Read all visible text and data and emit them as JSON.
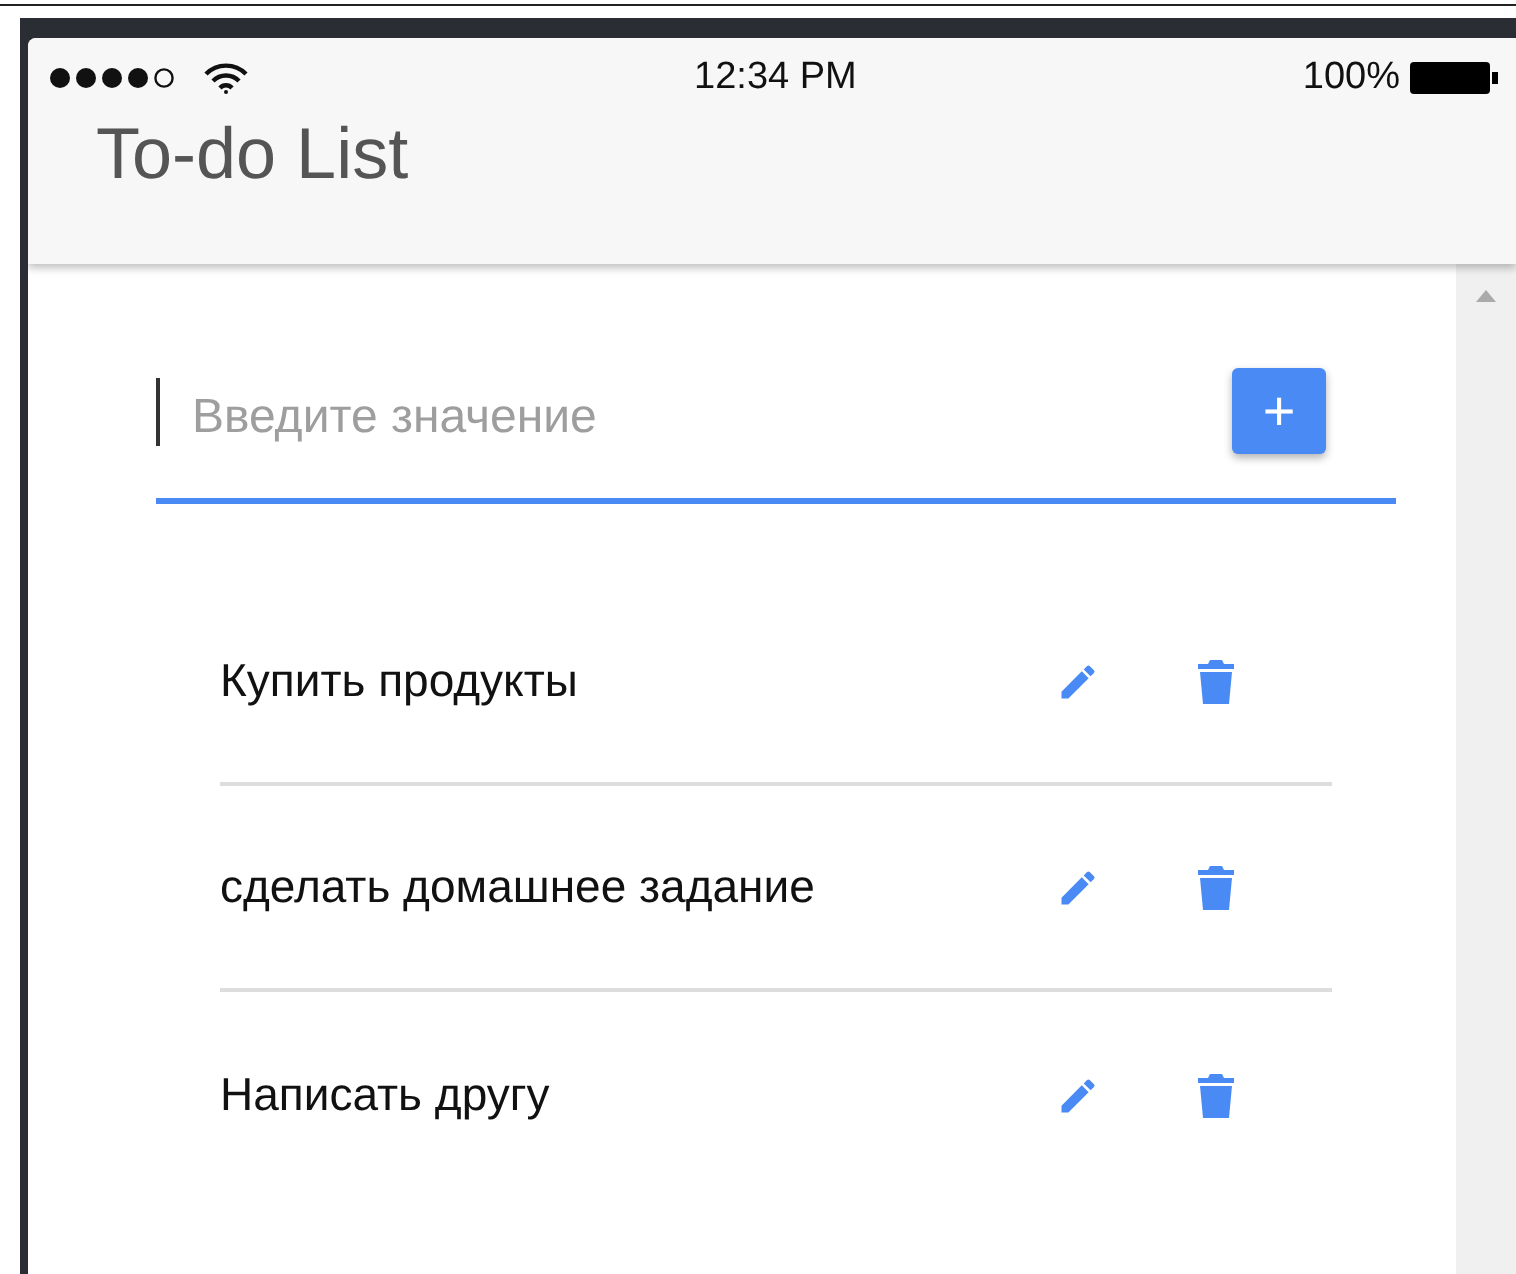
{
  "status_bar": {
    "time": "12:34 PM",
    "battery": "100%"
  },
  "app_bar": {
    "title": "To-do List"
  },
  "new_item": {
    "placeholder": "Введите значение",
    "add_button": "+"
  },
  "items": [
    {
      "text": "Купить продукты"
    },
    {
      "text": "сделать домашнее задание"
    },
    {
      "text": "Написать другу"
    }
  ]
}
